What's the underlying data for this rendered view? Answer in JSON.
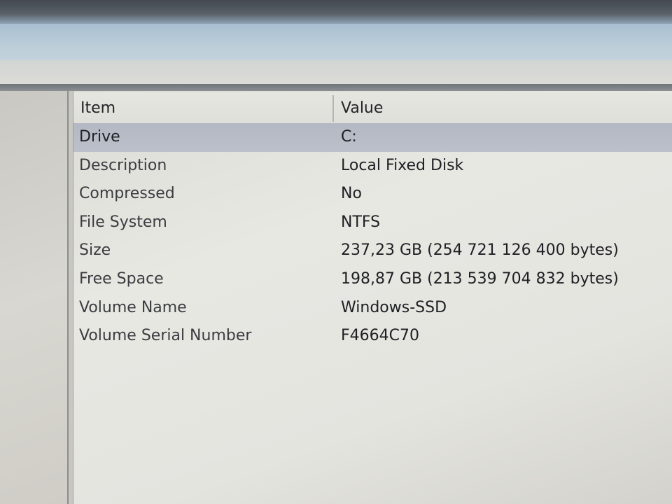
{
  "table": {
    "columns": {
      "item": "Item",
      "value": "Value"
    },
    "rows": [
      {
        "item": "Drive",
        "value": "C:",
        "selected": true
      },
      {
        "item": "Description",
        "value": "Local Fixed Disk"
      },
      {
        "item": "Compressed",
        "value": "No"
      },
      {
        "item": "File System",
        "value": "NTFS"
      },
      {
        "item": "Size",
        "value": "237,23 GB (254 721 126 400 bytes)"
      },
      {
        "item": "Free Space",
        "value": "198,87 GB (213 539 704 832 bytes)"
      },
      {
        "item": "Volume Name",
        "value": "Windows-SSD"
      },
      {
        "item": "Volume Serial Number",
        "value": "F4664C70"
      }
    ]
  }
}
